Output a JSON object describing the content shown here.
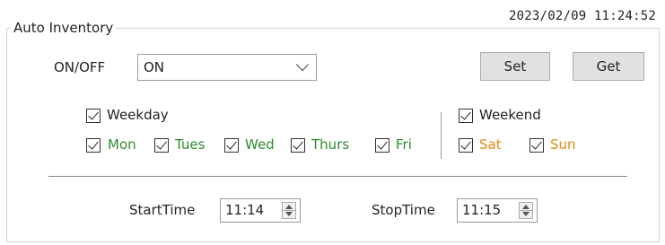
{
  "group": {
    "title": "Auto Inventory"
  },
  "timestamp": "2023/02/09 11:24:52",
  "onoff": {
    "label": "ON/OFF",
    "value": "ON"
  },
  "buttons": {
    "set": "Set",
    "get": "Get"
  },
  "weekday": {
    "label": "Weekday",
    "checked": true,
    "days": [
      {
        "label": "Mon",
        "checked": true
      },
      {
        "label": "Tues",
        "checked": true
      },
      {
        "label": "Wed",
        "checked": true
      },
      {
        "label": "Thurs",
        "checked": true
      },
      {
        "label": "Fri",
        "checked": true
      }
    ]
  },
  "weekend": {
    "label": "Weekend",
    "checked": true,
    "days": [
      {
        "label": "Sat",
        "checked": true
      },
      {
        "label": "Sun",
        "checked": true
      }
    ]
  },
  "colors": {
    "weekday_days": "#2e8b2e",
    "weekend_days": "#e08a14"
  },
  "start_time": {
    "label": "StartTime",
    "value": "11:14"
  },
  "stop_time": {
    "label": "StopTime",
    "value": "11:15"
  }
}
